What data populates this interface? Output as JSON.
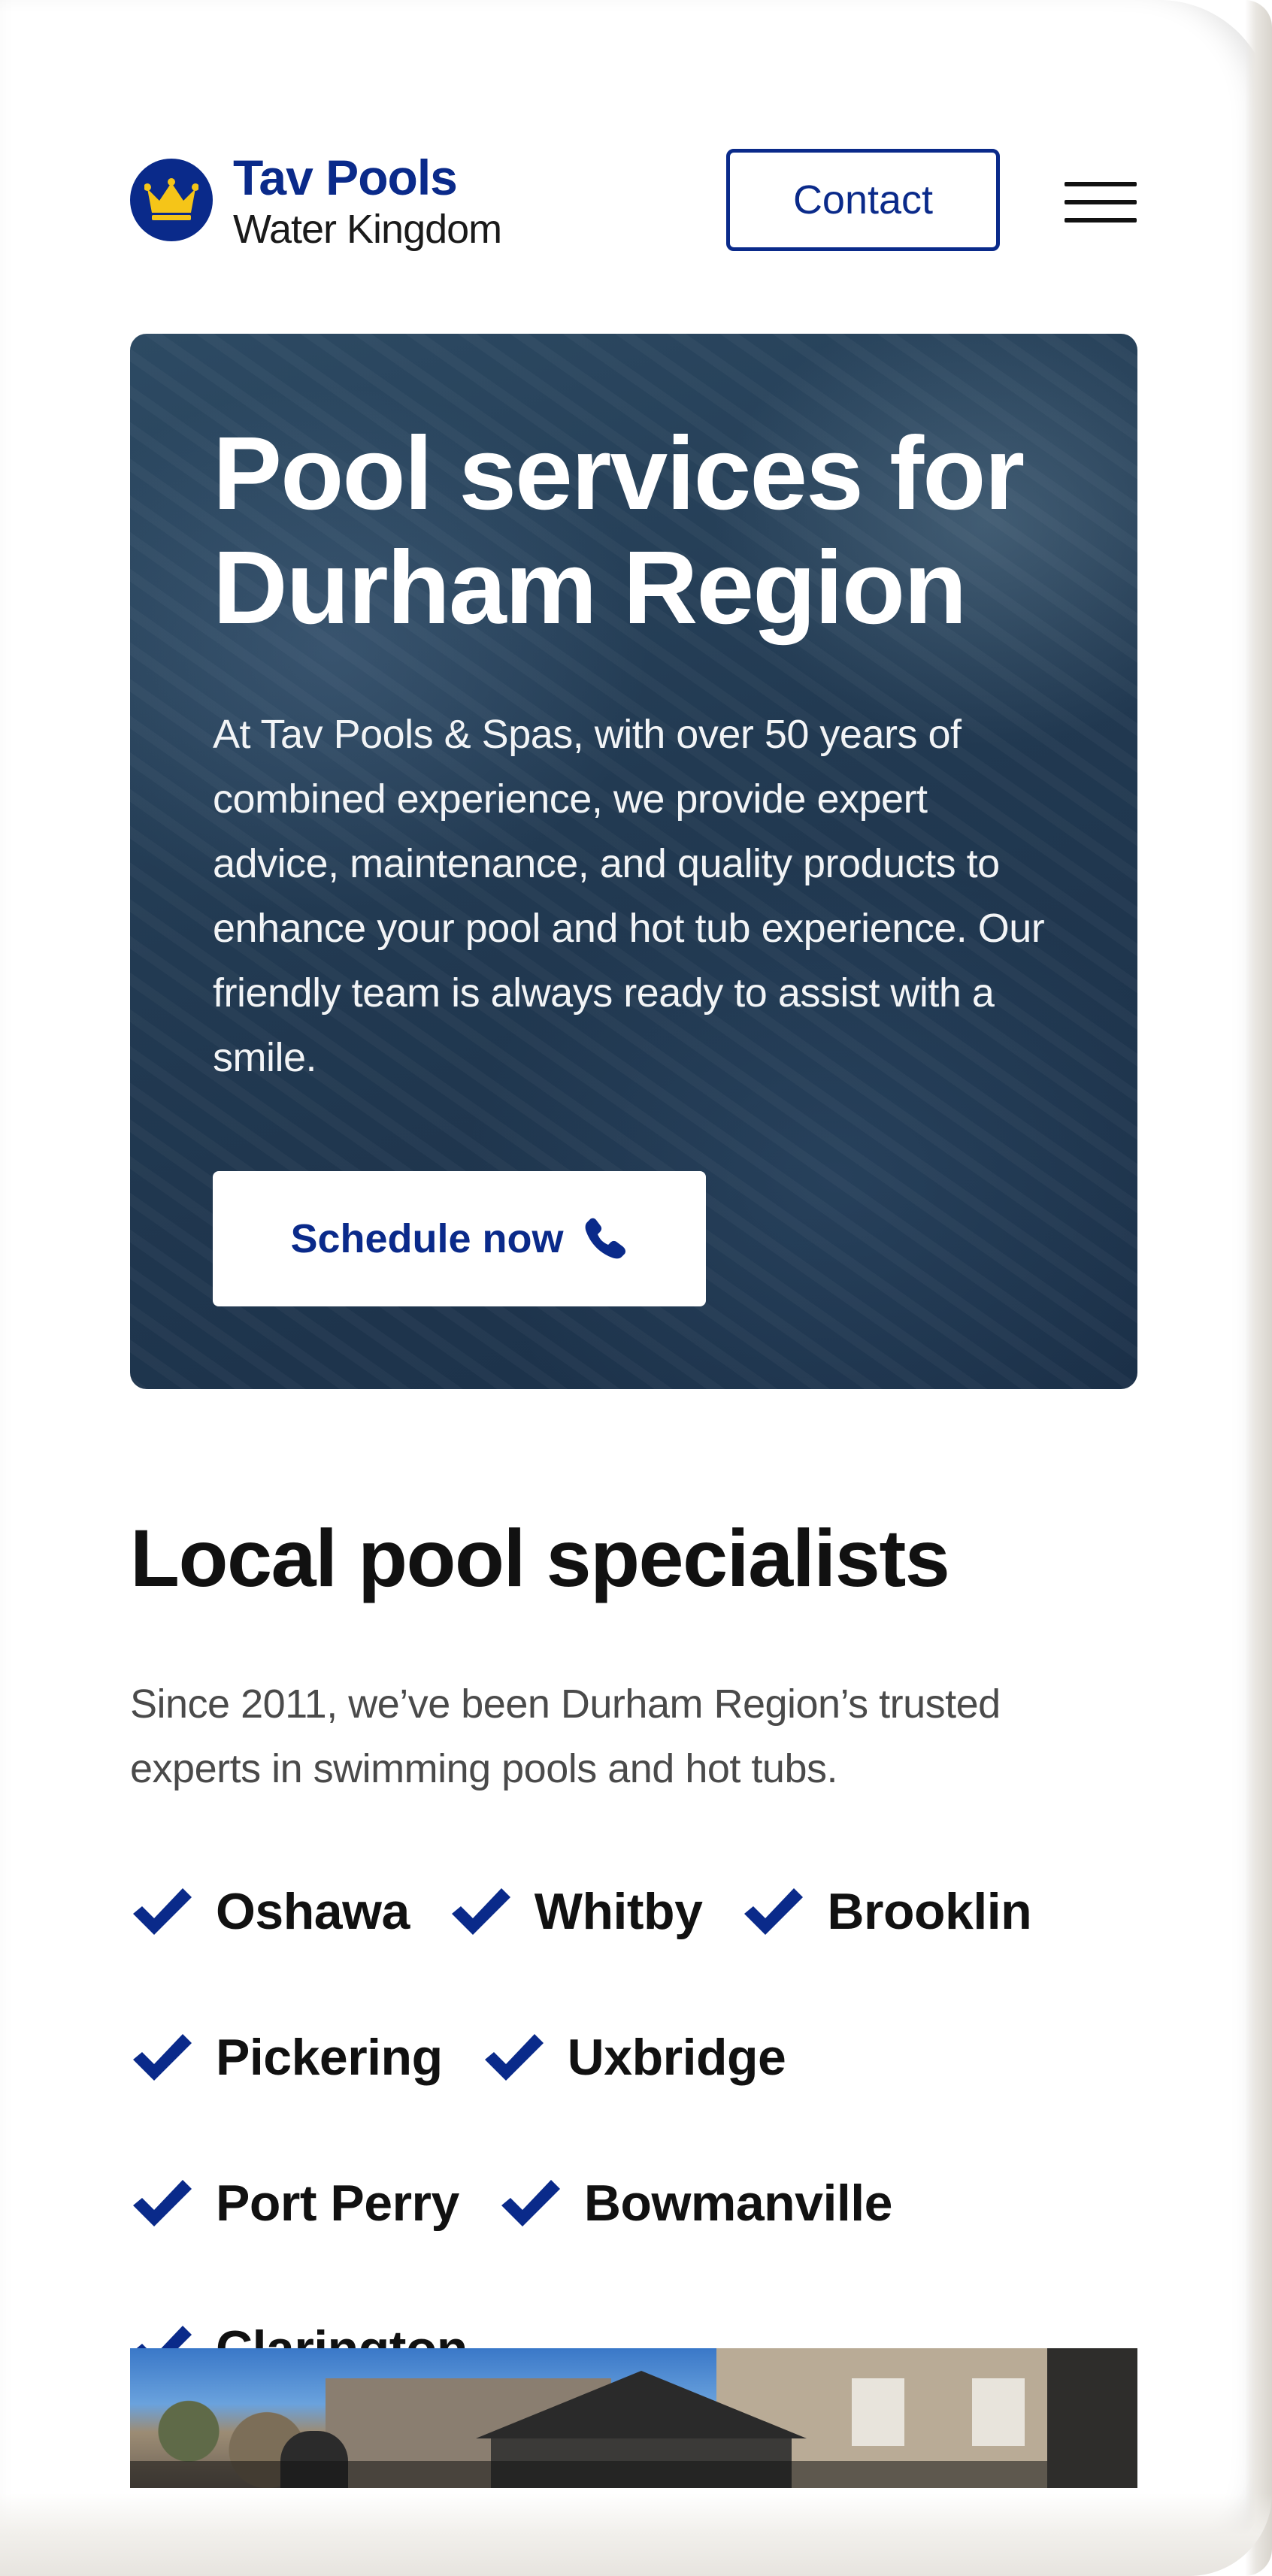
{
  "header": {
    "brand_title": "Tav Pools",
    "brand_subtitle": "Water Kingdom",
    "logo_icon": "crown-icon",
    "contact_label": "Contact",
    "menu_icon": "hamburger-menu-icon"
  },
  "hero": {
    "title_line1": "Pool services for",
    "title_line2": "Durham Region",
    "description": "At Tav Pools & Spas, with over 50 years of combined experience, we provide expert advice, maintenance, and quality products to enhance your pool and hot tub experience. Our friendly team is always ready to assist with a smile.",
    "cta_label": "Schedule now",
    "cta_icon": "phone-icon"
  },
  "local": {
    "title": "Local pool specialists",
    "description": "Since 2011, we’ve been Durham Region’s trusted experts in swimming pools and hot tubs.",
    "towns": [
      "Oshawa",
      "Whitby",
      "Brooklin",
      "Pickering",
      "Uxbridge",
      "Port Perry",
      "Bowmanville",
      "Clarington"
    ],
    "check_icon": "checkmark-icon"
  },
  "colors": {
    "brand_blue": "#0a2a8a",
    "crown_gold": "#f5c518",
    "hero_bg": "#223a52",
    "text_dark": "#111111",
    "text_muted": "#4a4a4a"
  }
}
